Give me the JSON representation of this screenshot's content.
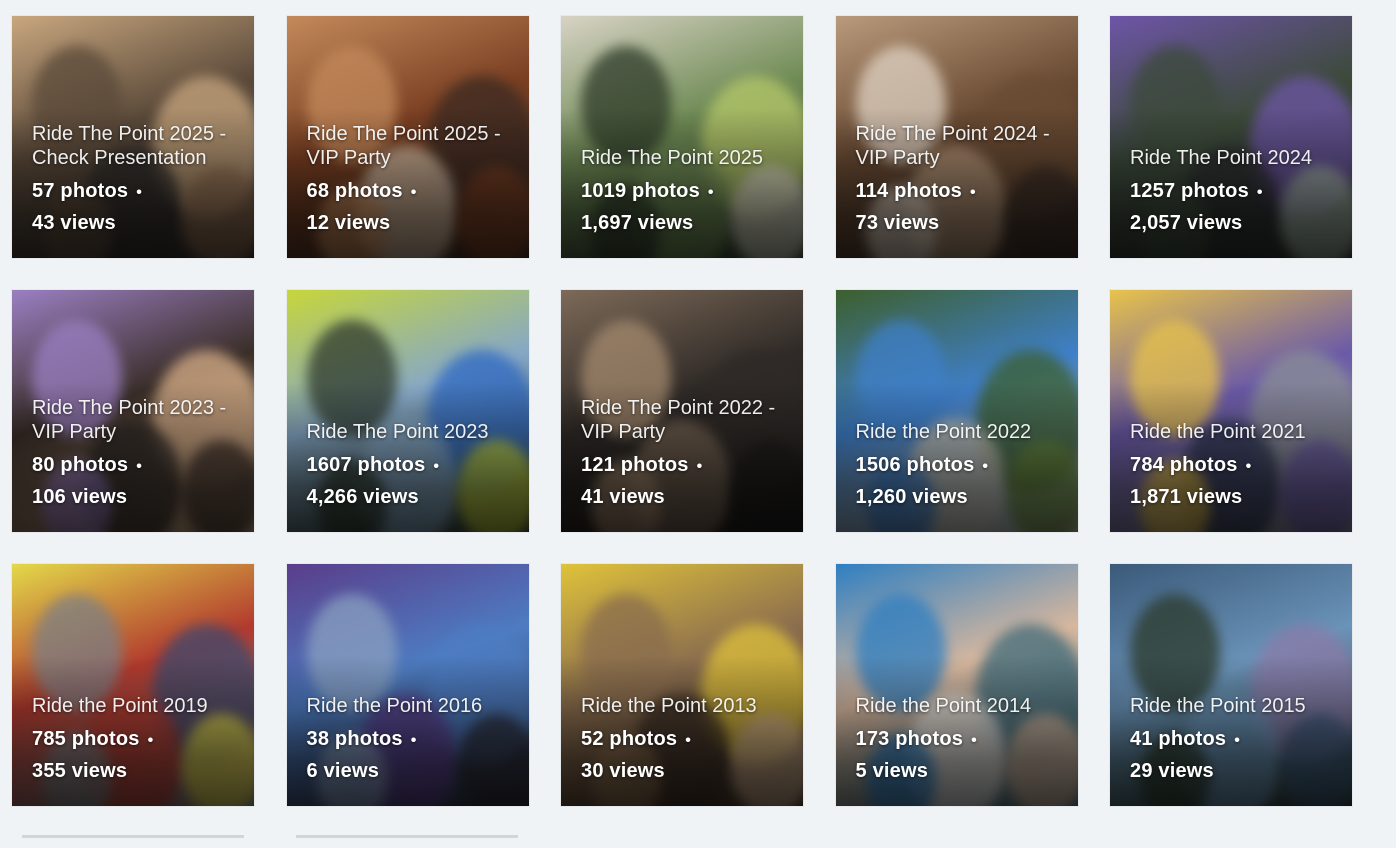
{
  "albums": [
    {
      "title": "Ride The Point 2025 - Check Presentation",
      "photos": "57 photos",
      "views": "43 views",
      "colors": [
        "#5b4a3a",
        "#c9a77f",
        "#2e2b2a",
        "#8d6b4e"
      ]
    },
    {
      "title": "Ride The Point 2025 - VIP Party",
      "photos": "68 photos",
      "views": "12 views",
      "colors": [
        "#7a3f22",
        "#c48a5b",
        "#3b2a22",
        "#d9c2a8"
      ]
    },
    {
      "title": "Ride The Point 2025",
      "photos": "1019 photos",
      "views": "1,697 views",
      "colors": [
        "#6f8b55",
        "#d8d3c5",
        "#2f3b2a",
        "#b7c96a"
      ]
    },
    {
      "title": "Ride The Point 2024 - VIP Party",
      "photos": "114 photos",
      "views": "73 views",
      "colors": [
        "#6a4b33",
        "#b99a7c",
        "#3a2d26",
        "#e0d3c4"
      ]
    },
    {
      "title": "Ride The Point 2024",
      "photos": "1257 photos",
      "views": "2,057 views",
      "colors": [
        "#3c4a3a",
        "#6e55a8",
        "#2a2c2e",
        "#9fb0a0"
      ]
    },
    {
      "title": "Ride The Point 2023 - VIP Party",
      "photos": "80 photos",
      "views": "106 views",
      "colors": [
        "#3a2e28",
        "#9b7fc2",
        "#d9b08a",
        "#2a2624"
      ]
    },
    {
      "title": "Ride The Point 2023",
      "photos": "1607 photos",
      "views": "4,266 views",
      "colors": [
        "#86a8c6",
        "#c7d63a",
        "#2f3a2c",
        "#2e68c0"
      ]
    },
    {
      "title": "Ride The Point 2022 - VIP Party",
      "photos": "121 photos",
      "views": "41 views",
      "colors": [
        "#2f2a27",
        "#7d6a58",
        "#1e1c1b",
        "#a58a6e"
      ]
    },
    {
      "title": "Ride the Point 2022",
      "photos": "1506 photos",
      "views": "1,260 views",
      "colors": [
        "#3f7fc8",
        "#3d5f2d",
        "#c9c6b8",
        "#6b8c3e"
      ]
    },
    {
      "title": "Ride the Point 2021",
      "photos": "784 photos",
      "views": "1,871 views",
      "colors": [
        "#6b5aa8",
        "#e8c34a",
        "#8a8f96",
        "#2c3550"
      ]
    },
    {
      "title": "Ride the Point 2019",
      "photos": "785 photos",
      "views": "355 views",
      "colors": [
        "#b23a2e",
        "#e3d94a",
        "#7c7f84",
        "#3d4a6e"
      ]
    },
    {
      "title": "Ride the Point 2016",
      "photos": "38 photos",
      "views": "6 views",
      "colors": [
        "#4d7cc2",
        "#5a3d8a",
        "#2c2b35",
        "#8aa0c0"
      ]
    },
    {
      "title": "Ride the Point 2013",
      "photos": "52 photos",
      "views": "30 views",
      "colors": [
        "#8a6d4e",
        "#e0c23a",
        "#3a2d24",
        "#c9a98a"
      ]
    },
    {
      "title": "Ride the Point 2014",
      "photos": "173 photos",
      "views": "5 views",
      "colors": [
        "#d7b79e",
        "#2f7fc1",
        "#3d6a7a",
        "#e8e4df"
      ]
    },
    {
      "title": "Ride the Point 2015",
      "photos": "41 photos",
      "views": "29 views",
      "colors": [
        "#6a93b8",
        "#3b5a7a",
        "#2c3a2a",
        "#8a7aa8"
      ]
    }
  ]
}
